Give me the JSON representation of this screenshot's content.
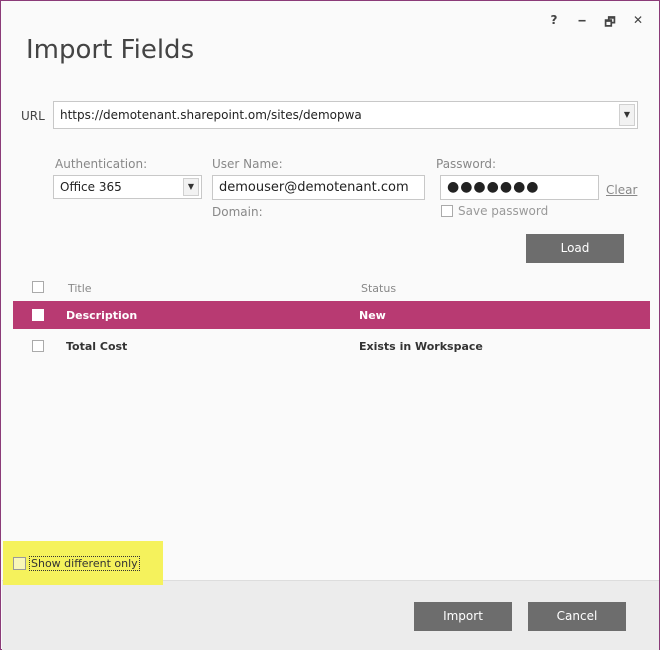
{
  "window": {
    "title": "Import Fields",
    "controls": {
      "help": "?",
      "minimize": "‒",
      "restore": "🗗",
      "close": "✕"
    }
  },
  "url": {
    "label": "URL",
    "value": "https://demotenant.sharepoint.om/sites/demopwa"
  },
  "auth": {
    "label": "Authentication:",
    "selected": "Office 365"
  },
  "user": {
    "label": "User Name:",
    "value": "demouser@demotenant.com",
    "domain_label": "Domain:"
  },
  "password": {
    "label": "Password:",
    "value": "●●●●●●●",
    "clear_label": "Clear",
    "save_label": "Save password"
  },
  "load_label": "Load",
  "table": {
    "headers": {
      "title": "Title",
      "status": "Status"
    },
    "rows": [
      {
        "title": "Description",
        "status": "New"
      },
      {
        "title": "Total Cost",
        "status": "Exists in Workspace"
      }
    ]
  },
  "footer": {
    "show_different_label": "Show different only",
    "import_label": "Import",
    "cancel_label": "Cancel"
  },
  "colors": {
    "accent": "#b83a72",
    "button": "#6d6d6d",
    "highlight": "#f5f25c"
  }
}
